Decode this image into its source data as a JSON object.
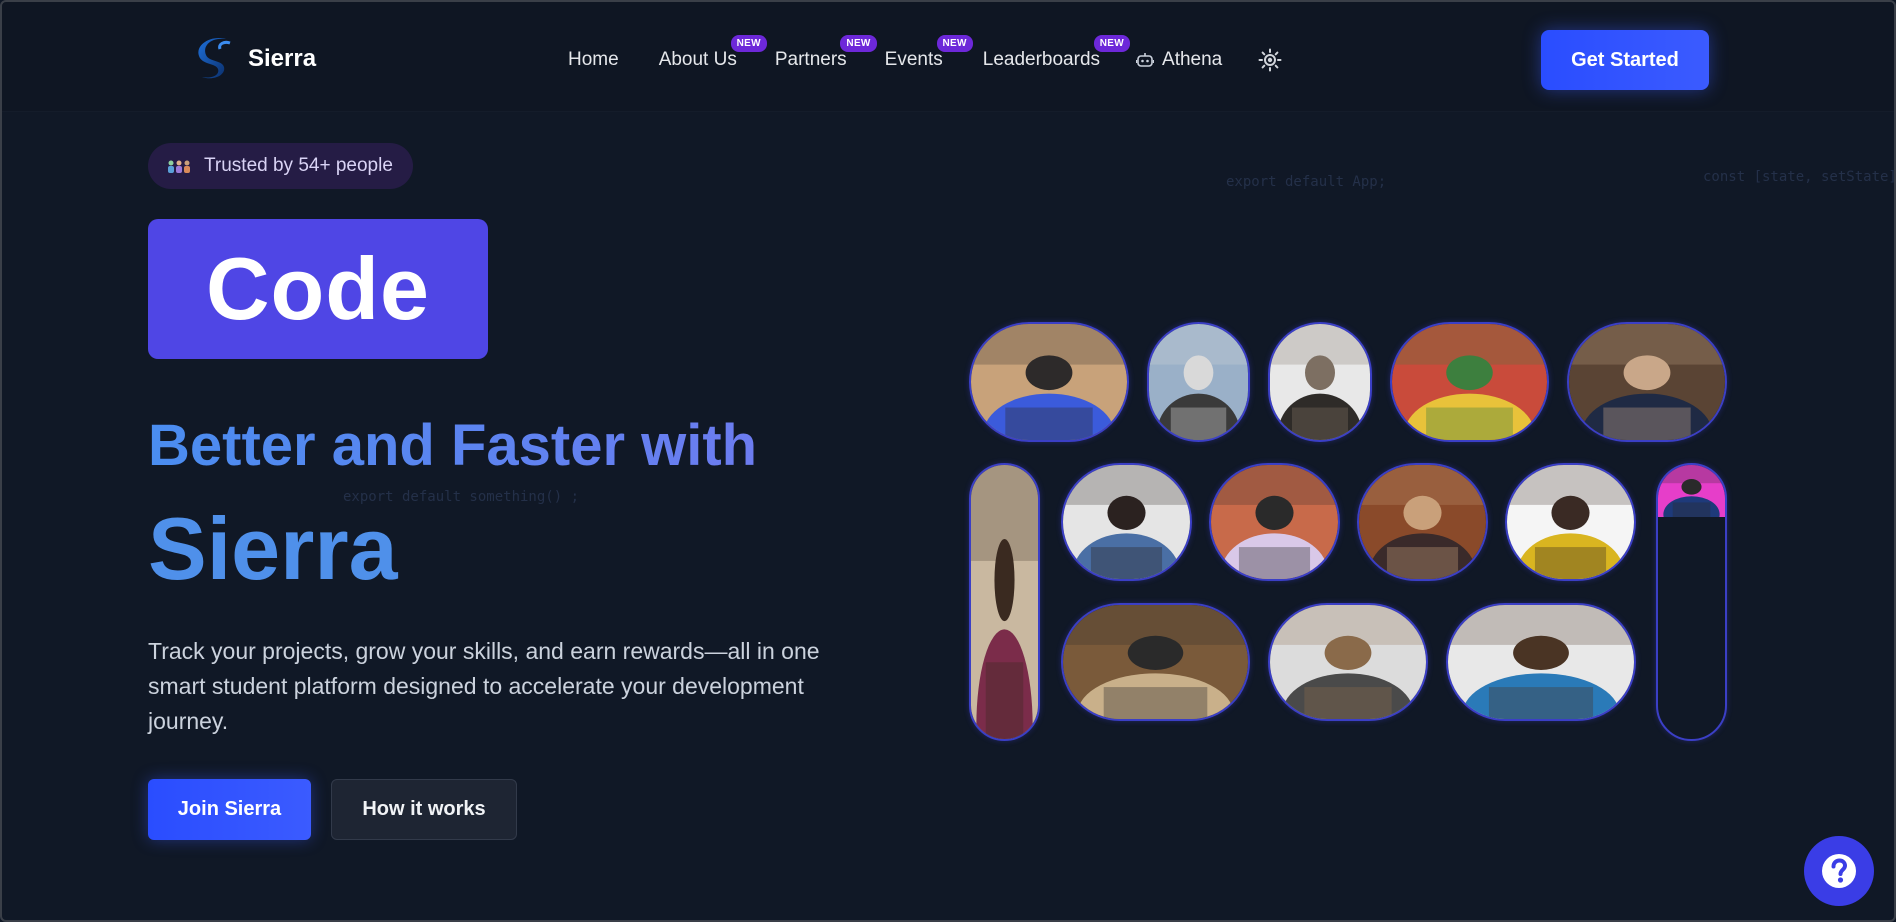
{
  "nav": {
    "brand": "Sierra",
    "links": [
      {
        "label": "Home",
        "badge": ""
      },
      {
        "label": "About Us",
        "badge": "NEW"
      },
      {
        "label": "Partners",
        "badge": "NEW"
      },
      {
        "label": "Events",
        "badge": "NEW"
      },
      {
        "label": "Leaderboards",
        "badge": "NEW"
      },
      {
        "label": "Athena",
        "badge": ""
      }
    ],
    "icons": {
      "athena": "robot-icon",
      "theme": "sun-icon"
    },
    "cta_label": "Get Started"
  },
  "hero": {
    "trusted_label": "Trusted by 54+ people",
    "code_word": "Code",
    "headline_line1": "Better and Faster with",
    "headline_line2": "Sierra",
    "description": "Track your projects, grow your skills, and earn rewards—all in one smart student platform designed to accelerate your development journey.",
    "primary_button": "Join Sierra",
    "secondary_button": "How it works",
    "ghost_code": [
      "export default App;",
      "const [state, setState] = us",
      "export default something() ;"
    ]
  },
  "colors": {
    "background": "#101826",
    "accent": "#4f46e5",
    "button": "#2a4dff",
    "badge": "#6d28d9",
    "headline": "#4f90ea"
  },
  "gallery": {
    "photos": [
      {
        "name": "photo-student-laptop-hoodie",
        "palette": [
          "#c8a27a",
          "#3b5bdb",
          "#2d2a2a"
        ]
      },
      {
        "name": "photo-student-desk",
        "palette": [
          "#9ab0c8",
          "#3a3a3a",
          "#d9d9d9"
        ]
      },
      {
        "name": "photo-group-laptop",
        "palette": [
          "#e8e8e8",
          "#2e2b28",
          "#7d6f62"
        ]
      },
      {
        "name": "photo-group-study-table",
        "palette": [
          "#c94b3b",
          "#e8c23a",
          "#3d7f3e"
        ]
      },
      {
        "name": "photo-student-portrait-office",
        "palette": [
          "#5a4434",
          "#1f2a44",
          "#c9a789"
        ]
      },
      {
        "name": "photo-student-headphones-tall",
        "palette": [
          "#c9b8a0",
          "#7b2c4a",
          "#3a2a20"
        ]
      },
      {
        "name": "photo-students-writing",
        "palette": [
          "#e5e5e5",
          "#4a6fa5",
          "#2b2220"
        ]
      },
      {
        "name": "photo-student-tablet-smile",
        "palette": [
          "#c86a4a",
          "#d9c8e8",
          "#2a2a2a"
        ]
      },
      {
        "name": "photo-group-cafe",
        "palette": [
          "#8a4a2a",
          "#3a2a2a",
          "#c9a07a"
        ]
      },
      {
        "name": "photo-student-books-yellow",
        "palette": [
          "#f5f5f5",
          "#d9b520",
          "#3a2a24"
        ]
      },
      {
        "name": "photo-student-pink-partial",
        "palette": [
          "#e63ec9",
          "#1e3a7a",
          "#2a2a2a"
        ]
      },
      {
        "name": "photo-boy-computer-library",
        "palette": [
          "#7a5a3a",
          "#c9b08a",
          "#2a2a2a"
        ]
      },
      {
        "name": "photo-man-imac-glasses",
        "palette": [
          "#dcdcdc",
          "#4a4a4a",
          "#8a6a4a"
        ]
      },
      {
        "name": "photo-man-laptop-blue-shirt",
        "palette": [
          "#e8e8e8",
          "#2a7ab8",
          "#4a3424"
        ]
      }
    ]
  },
  "help": {
    "icon": "question-icon"
  }
}
